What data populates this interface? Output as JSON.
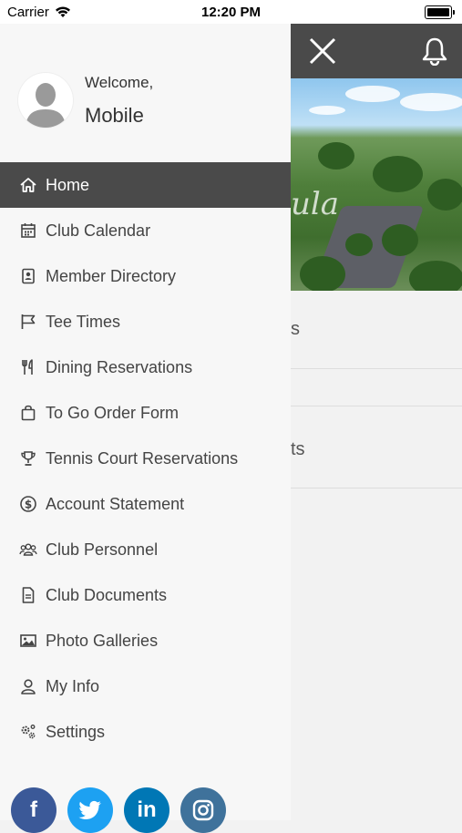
{
  "status_bar": {
    "carrier": "Carrier",
    "time": "12:20 PM"
  },
  "header": {
    "close_icon": "close-icon",
    "bell_icon": "bell-icon"
  },
  "hero": {
    "script_text": "ula"
  },
  "background_list": [
    {
      "text": "s"
    },
    {
      "text": ""
    },
    {
      "text": "ts"
    }
  ],
  "drawer": {
    "welcome": "Welcome,",
    "username": "Mobile",
    "menu": [
      {
        "label": "Home",
        "icon": "home-icon",
        "active": true
      },
      {
        "label": "Club Calendar",
        "icon": "calendar-icon"
      },
      {
        "label": "Member Directory",
        "icon": "directory-icon"
      },
      {
        "label": "Tee Times",
        "icon": "flag-icon"
      },
      {
        "label": "Dining Reservations",
        "icon": "utensils-icon"
      },
      {
        "label": "To Go Order Form",
        "icon": "shopping-bag-icon"
      },
      {
        "label": "Tennis Court Reservations",
        "icon": "trophy-icon"
      },
      {
        "label": "Account Statement",
        "icon": "dollar-icon"
      },
      {
        "label": "Club Personnel",
        "icon": "people-icon"
      },
      {
        "label": "Club Documents",
        "icon": "document-icon"
      },
      {
        "label": "Photo Galleries",
        "icon": "image-icon"
      },
      {
        "label": "My Info",
        "icon": "user-icon"
      },
      {
        "label": "Settings",
        "icon": "gears-icon"
      }
    ],
    "social": [
      {
        "name": "facebook",
        "glyph": "f",
        "color": "#3b5998"
      },
      {
        "name": "twitter",
        "glyph": "t",
        "color": "#1da1f2"
      },
      {
        "name": "linkedin",
        "glyph": "in",
        "color": "#0077b5"
      },
      {
        "name": "instagram",
        "glyph": "ig",
        "color": "#3f729b"
      }
    ]
  },
  "colors": {
    "topbar": "#4a4a4a",
    "active_item": "#4a4a4a",
    "drawer_bg": "#f7f7f7"
  }
}
